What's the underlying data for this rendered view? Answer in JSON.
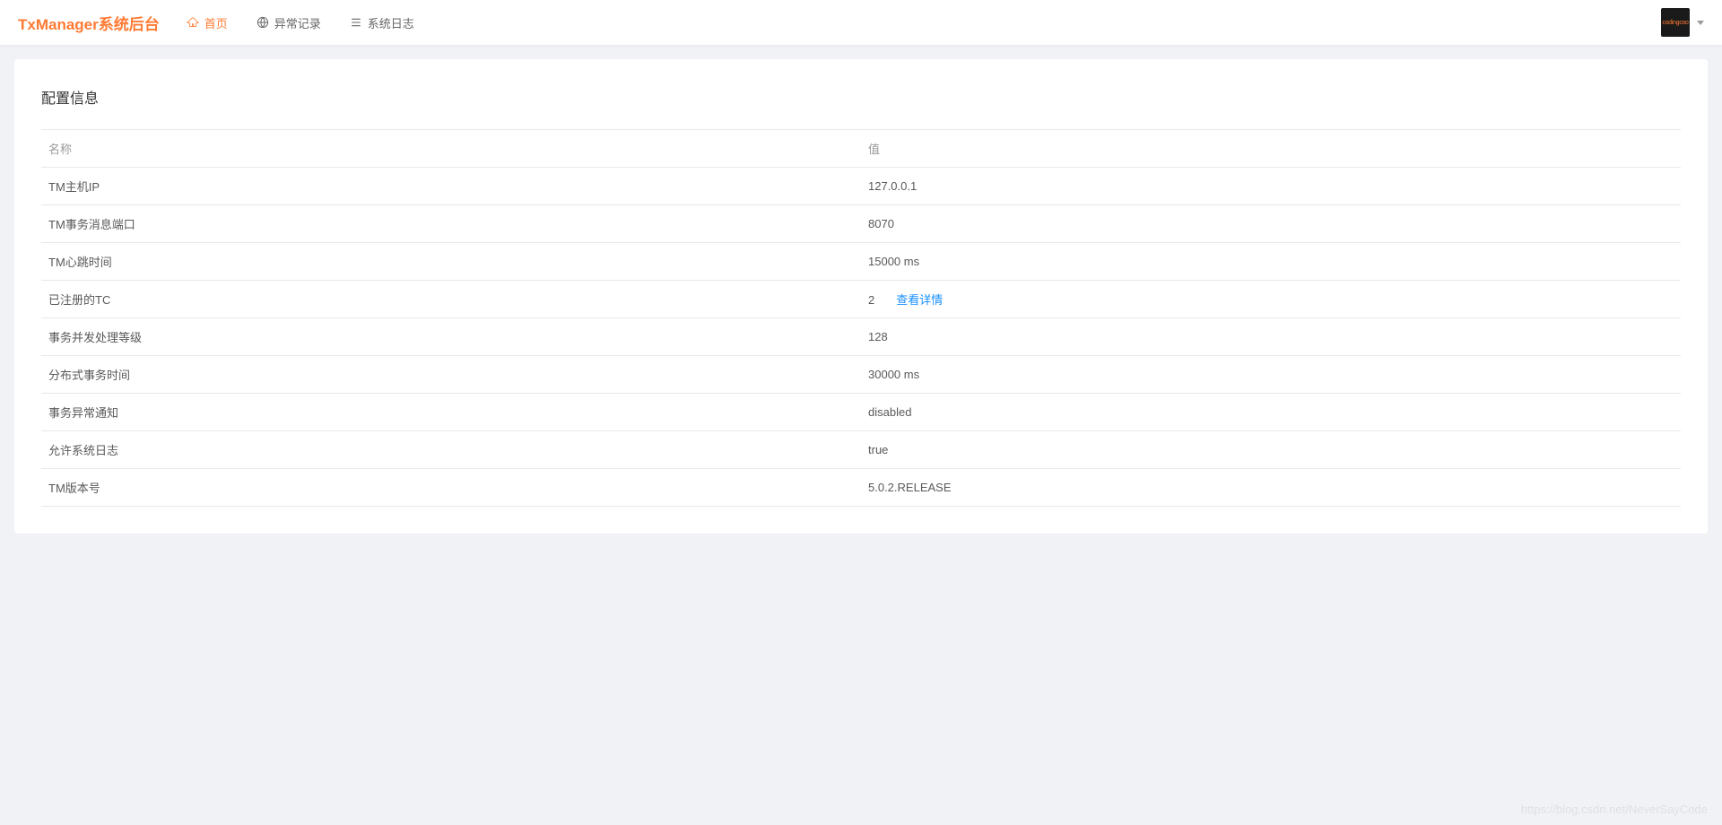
{
  "header": {
    "brand": "TxManager系统后台",
    "nav": [
      {
        "label": "首页",
        "active": true,
        "icon": "home"
      },
      {
        "label": "异常记录",
        "active": false,
        "icon": "globe"
      },
      {
        "label": "系统日志",
        "active": false,
        "icon": "list"
      }
    ],
    "avatar_text": "codingcoo"
  },
  "card": {
    "title": "配置信息",
    "columns": {
      "name": "名称",
      "value": "值"
    },
    "rows": [
      {
        "name": "TM主机IP",
        "value": "127.0.0.1"
      },
      {
        "name": "TM事务消息端口",
        "value": "8070"
      },
      {
        "name": "TM心跳时间",
        "value": "15000 ms"
      },
      {
        "name": "已注册的TC",
        "value": "2",
        "link": "查看详情"
      },
      {
        "name": "事务并发处理等级",
        "value": "128"
      },
      {
        "name": "分布式事务时间",
        "value": "30000 ms"
      },
      {
        "name": "事务异常通知",
        "value": "disabled"
      },
      {
        "name": "允许系统日志",
        "value": "true"
      },
      {
        "name": "TM版本号",
        "value": "5.0.2.RELEASE"
      }
    ]
  },
  "watermark": "https://blog.csdn.net/NeverSayCode"
}
